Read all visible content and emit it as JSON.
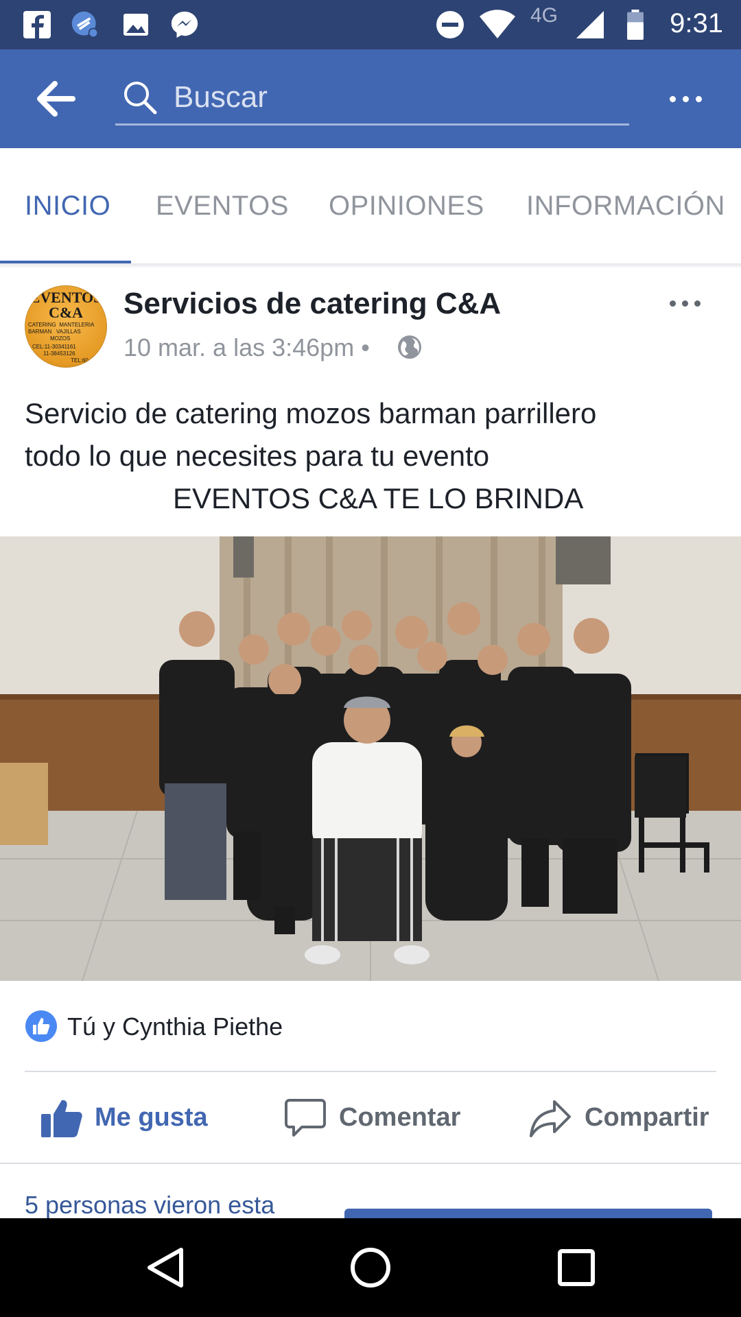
{
  "status_bar": {
    "time": "9:31",
    "network": "4G",
    "icons": [
      "facebook-icon",
      "data-saver-icon",
      "gallery-icon",
      "messenger-icon",
      "do-not-disturb-icon",
      "wifi-icon",
      "signal-icon",
      "battery-icon"
    ]
  },
  "search": {
    "placeholder": "Buscar"
  },
  "tabs": [
    {
      "label": "INICIO",
      "active": true
    },
    {
      "label": "EVENTOS",
      "active": false
    },
    {
      "label": "OPINIONES",
      "active": false
    },
    {
      "label": "INFORMACIÓN",
      "active": false
    }
  ],
  "post": {
    "page_name": "Servicios de catering C&A",
    "timestamp": "10 mar. a las 3:46pm",
    "separator": "•",
    "avatar": {
      "title": "EVENTOS C&A",
      "lines": [
        "CATERING  MANTELERIA",
        "BARMAN   VAJILLAS",
        "MOZOS",
        "CEL:11-30341161",
        "11-38453126",
        "TEL:60"
      ]
    },
    "text": {
      "line1": "Servicio de catering mozos barman parrillero",
      "line2": "todo lo que necesites para tu evento",
      "line3": "EVENTOS C&A TE LO BRINDA"
    },
    "reactions_text": "Tú y Cynthia Piethe",
    "actions": {
      "like": "Me gusta",
      "comment": "Comentar",
      "share": "Compartir"
    },
    "viewers": "5 personas vieron esta"
  },
  "colors": {
    "brand": "#4267b2",
    "status_bar": "#2d4373",
    "text_secondary": "#90949c"
  }
}
